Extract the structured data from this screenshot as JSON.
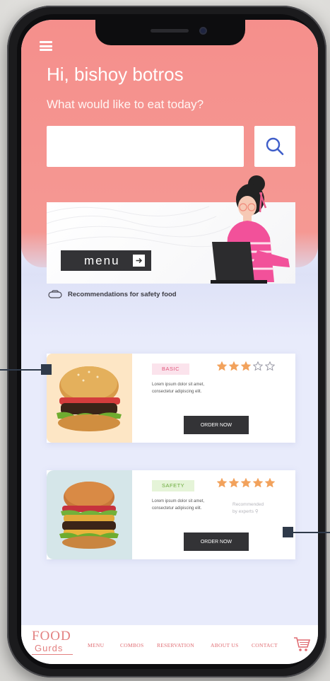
{
  "header": {
    "greeting": "Hi, bishoy botros",
    "subtitle": "What would like to  eat today?"
  },
  "search": {
    "value": "",
    "placeholder": ""
  },
  "banner": {
    "menu_label": "menu"
  },
  "safety": {
    "text": "Recommendations for safety food"
  },
  "cards": [
    {
      "badge": "BASIC",
      "rating": 3,
      "max_rating": 5,
      "desc_line1": "Lorem ipsum dolor sit amet,",
      "desc_line2": "consectetur adipiscing elit.",
      "button": "ORDER NOW",
      "bg_color": "#fde6c5"
    },
    {
      "badge": "SAFETY",
      "rating": 5,
      "max_rating": 5,
      "desc_line1": "Lorem ipsum dolor sit amet,",
      "desc_line2": "consectetur adipiscing elit.",
      "recommended_line1": "Recommended",
      "recommended_line2": "by experts",
      "button": "ORDER NOW",
      "bg_color": "#d5e6e9"
    }
  ],
  "footer": {
    "logo_top": "FOOD",
    "logo_bottom": "Gurds",
    "nav": [
      "MENU",
      "COMBOS",
      "RESERVATION",
      "ABOUT US",
      "CONTACT"
    ]
  },
  "colors": {
    "header": "#f58f8c",
    "background": "#e8ebfb",
    "dark_button": "#333336",
    "star": "#f2a25c",
    "accent_text": "#e06c72"
  },
  "icons": [
    "hamburger-icon",
    "search-icon",
    "arrow-right-icon",
    "star-icon",
    "star-outline-icon",
    "badge-icon",
    "cart-icon"
  ]
}
